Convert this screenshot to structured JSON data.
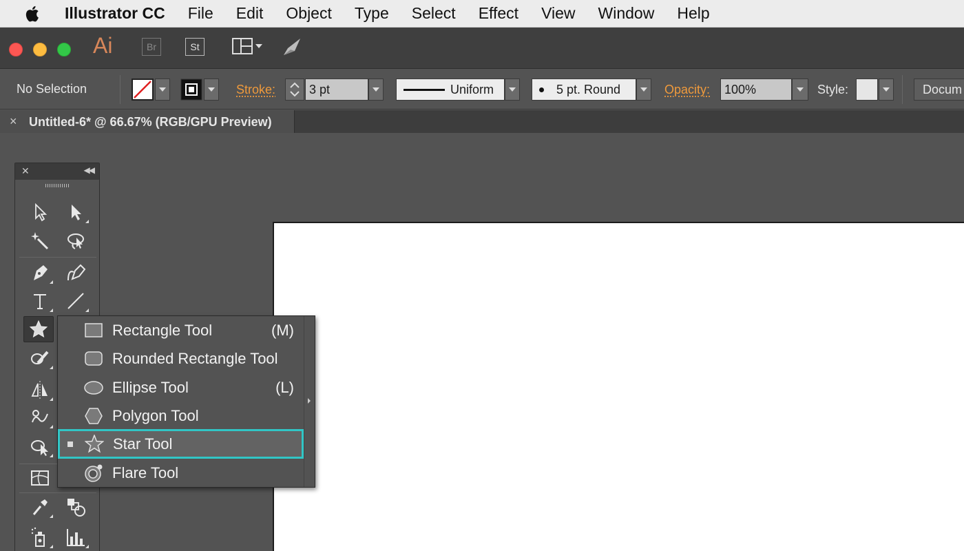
{
  "menubar": {
    "app_name": "Illustrator CC",
    "items": [
      "File",
      "Edit",
      "Object",
      "Type",
      "Select",
      "Effect",
      "View",
      "Window",
      "Help"
    ]
  },
  "appbar": {
    "logo": "Ai",
    "bridge_label": "Br",
    "stock_label": "St"
  },
  "controlbar": {
    "selection": "No Selection",
    "stroke_label": "Stroke:",
    "stroke_value": "3 pt",
    "profile_value": "Uniform",
    "brush_value": "5 pt. Round",
    "opacity_label": "Opacity:",
    "opacity_value": "100%",
    "style_label": "Style:",
    "document_button": "Docum"
  },
  "document_tab": {
    "close": "×",
    "title": "Untitled-6* @ 66.67% (RGB/GPU Preview)"
  },
  "flyout": {
    "items": [
      {
        "label": "Rectangle Tool",
        "shortcut": "(M)",
        "icon": "rectangle-icon"
      },
      {
        "label": "Rounded Rectangle Tool",
        "shortcut": "",
        "icon": "rounded-rectangle-icon"
      },
      {
        "label": "Ellipse Tool",
        "shortcut": "(L)",
        "icon": "ellipse-icon"
      },
      {
        "label": "Polygon Tool",
        "shortcut": "",
        "icon": "polygon-icon"
      },
      {
        "label": "Star Tool",
        "shortcut": "",
        "icon": "star-icon",
        "selected": true
      },
      {
        "label": "Flare Tool",
        "shortcut": "",
        "icon": "flare-icon"
      }
    ]
  },
  "colors": {
    "highlight": "#31c6c6",
    "ai_logo": "#d8875a",
    "orange_label": "#ef9a3c"
  }
}
